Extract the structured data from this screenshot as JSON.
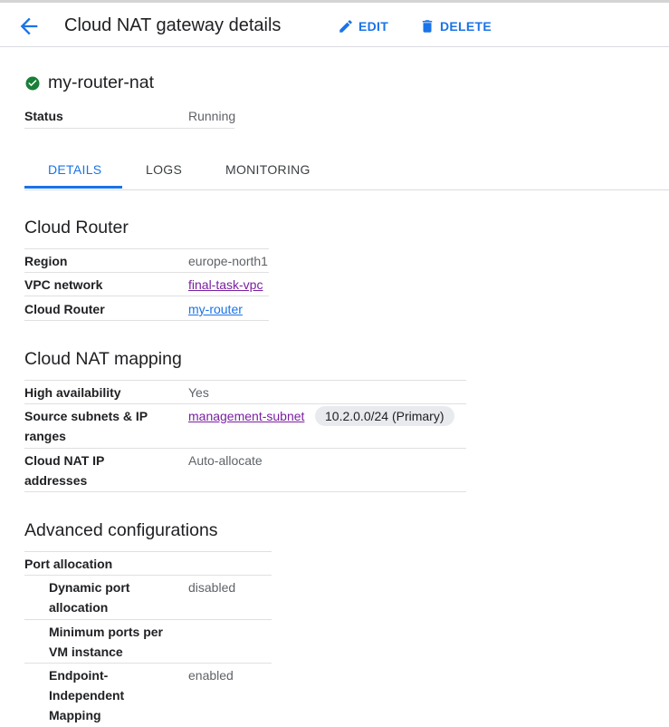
{
  "header": {
    "title": "Cloud NAT gateway details",
    "edit_label": "EDIT",
    "delete_label": "DELETE"
  },
  "resource": {
    "name": "my-router-nat",
    "status_key": "Status",
    "status_value": "Running"
  },
  "tabs": [
    {
      "label": "DETAILS",
      "active": true
    },
    {
      "label": "LOGS",
      "active": false
    },
    {
      "label": "MONITORING",
      "active": false
    }
  ],
  "cloud_router": {
    "title": "Cloud Router",
    "region_key": "Region",
    "region_value": "europe-north1",
    "vpc_key": "VPC network",
    "vpc_value": "final-task-vpc",
    "router_key": "Cloud Router",
    "router_value": "my-router"
  },
  "nat_mapping": {
    "title": "Cloud NAT mapping",
    "ha_key": "High availability",
    "ha_value": "Yes",
    "subnets_key_line1": "Source subnets & IP",
    "subnets_key_line2": "ranges",
    "subnet_link": "management-subnet",
    "subnet_range": "10.2.0.0/24 (Primary)",
    "ip_key_line1": "Cloud NAT IP",
    "ip_key_line2": "addresses",
    "ip_value": "Auto-allocate"
  },
  "advanced": {
    "title": "Advanced configurations",
    "port_allocation": "Port allocation",
    "dynamic_key_line1": "Dynamic port",
    "dynamic_key_line2": "allocation",
    "dynamic_value": "disabled",
    "min_ports_line1": "Minimum ports per",
    "min_ports_line2": "VM instance",
    "endpoint_line1": "Endpoint-",
    "endpoint_line2": "Independent",
    "endpoint_line3": "Mapping",
    "endpoint_value": "enabled"
  },
  "colors": {
    "accent": "#1a73e8",
    "visited_link": "#7b1fa2",
    "success": "#188038"
  }
}
